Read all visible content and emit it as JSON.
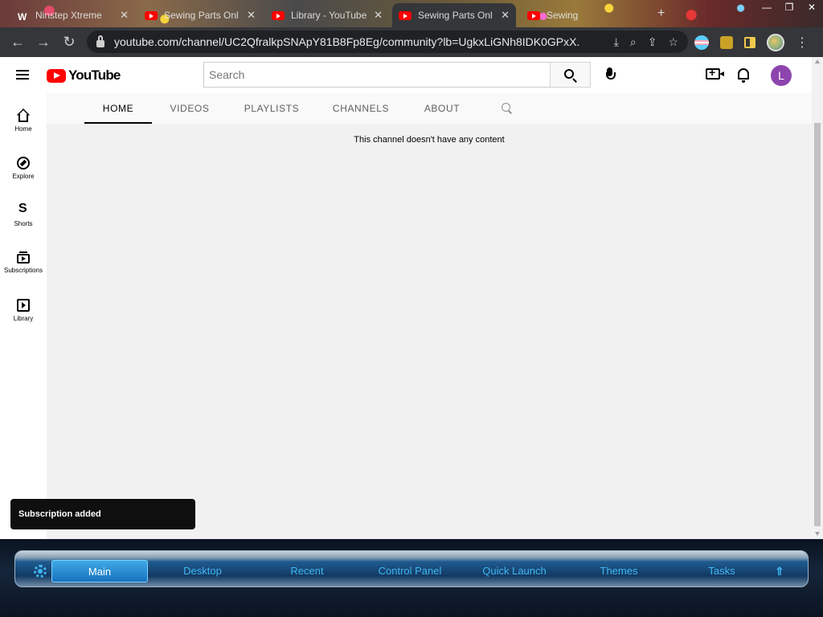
{
  "browser": {
    "tabs": [
      {
        "title": "Ninstep Xtreme",
        "icon": "wordpress-icon",
        "active": false
      },
      {
        "title": "Sewing Parts Onl",
        "icon": "youtube-icon",
        "active": false
      },
      {
        "title": "Library - YouTube",
        "icon": "youtube-icon",
        "active": false
      },
      {
        "title": "Sewing Parts Onl",
        "icon": "youtube-icon",
        "active": true
      },
      {
        "title": "Sewing",
        "icon": "youtube-icon",
        "active": false
      }
    ],
    "url": "youtube.com/channel/UC2QfralkpSNApY81B8Fp8Eg/community?lb=UgkxLiGNh8IDK0GPxX..."
  },
  "youtube": {
    "logo_text": "YouTube",
    "search_placeholder": "Search",
    "avatar_letter": "L",
    "avatar_color": "#8e44ad",
    "guide": [
      {
        "label": "Home",
        "icon": "home-icon"
      },
      {
        "label": "Explore",
        "icon": "explore-icon"
      },
      {
        "label": "Shorts",
        "icon": "shorts-icon"
      },
      {
        "label": "Subscriptions",
        "icon": "subscriptions-icon"
      },
      {
        "label": "Library",
        "icon": "library-icon"
      }
    ],
    "channel_tabs": [
      "HOME",
      "VIDEOS",
      "PLAYLISTS",
      "CHANNELS",
      "ABOUT"
    ],
    "active_tab": "HOME",
    "empty_message": "This channel doesn't have any content",
    "toast": "Subscription added"
  },
  "dock": {
    "items": [
      "Main",
      "Desktop",
      "Recent",
      "Control Panel",
      "Quick Launch",
      "Themes",
      "Tasks"
    ],
    "active": "Main"
  }
}
